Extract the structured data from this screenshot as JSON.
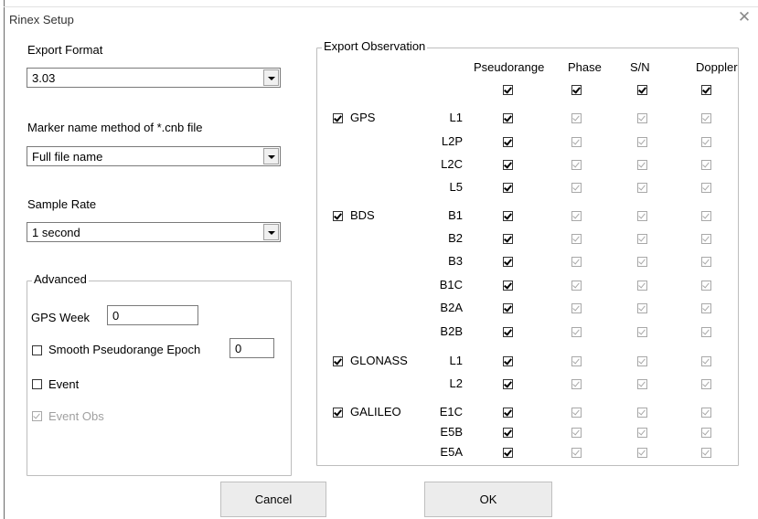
{
  "window": {
    "title": "Rinex Setup",
    "close_glyph": "✕"
  },
  "export_format": {
    "label": "Export Format",
    "value": "3.03"
  },
  "marker_name": {
    "label": "Marker name method of *.cnb file",
    "value": "Full file name"
  },
  "sample_rate": {
    "label": "Sample Rate",
    "value": "1 second"
  },
  "advanced": {
    "legend": "Advanced",
    "gps_week_label": "GPS Week",
    "gps_week_value": "0",
    "smooth_label": "Smooth Pseudorange Epoch",
    "smooth_checked": false,
    "smooth_value": "0",
    "event_label": "Event",
    "event_checked": false,
    "event_obs_label": "Event Obs",
    "event_obs_checked": true,
    "event_obs_enabled": false
  },
  "observation": {
    "legend": "Export Observation",
    "columns": [
      "Pseudorange",
      "Phase",
      "S/N",
      "Doppler"
    ],
    "header_checks": [
      true,
      true,
      true,
      true
    ],
    "systems": [
      {
        "name": "GPS",
        "checked": true,
        "bands": [
          "L1",
          "L2P",
          "L2C",
          "L5"
        ]
      },
      {
        "name": "BDS",
        "checked": true,
        "bands": [
          "B1",
          "B2",
          "B3",
          "B1C",
          "B2A",
          "B2B"
        ]
      },
      {
        "name": "GLONASS",
        "checked": true,
        "bands": [
          "L1",
          "L2"
        ]
      },
      {
        "name": "GALILEO",
        "checked": true,
        "bands": [
          "E1C",
          "E5B",
          "E5A"
        ]
      }
    ]
  },
  "buttons": {
    "cancel": "Cancel",
    "ok": "OK"
  }
}
